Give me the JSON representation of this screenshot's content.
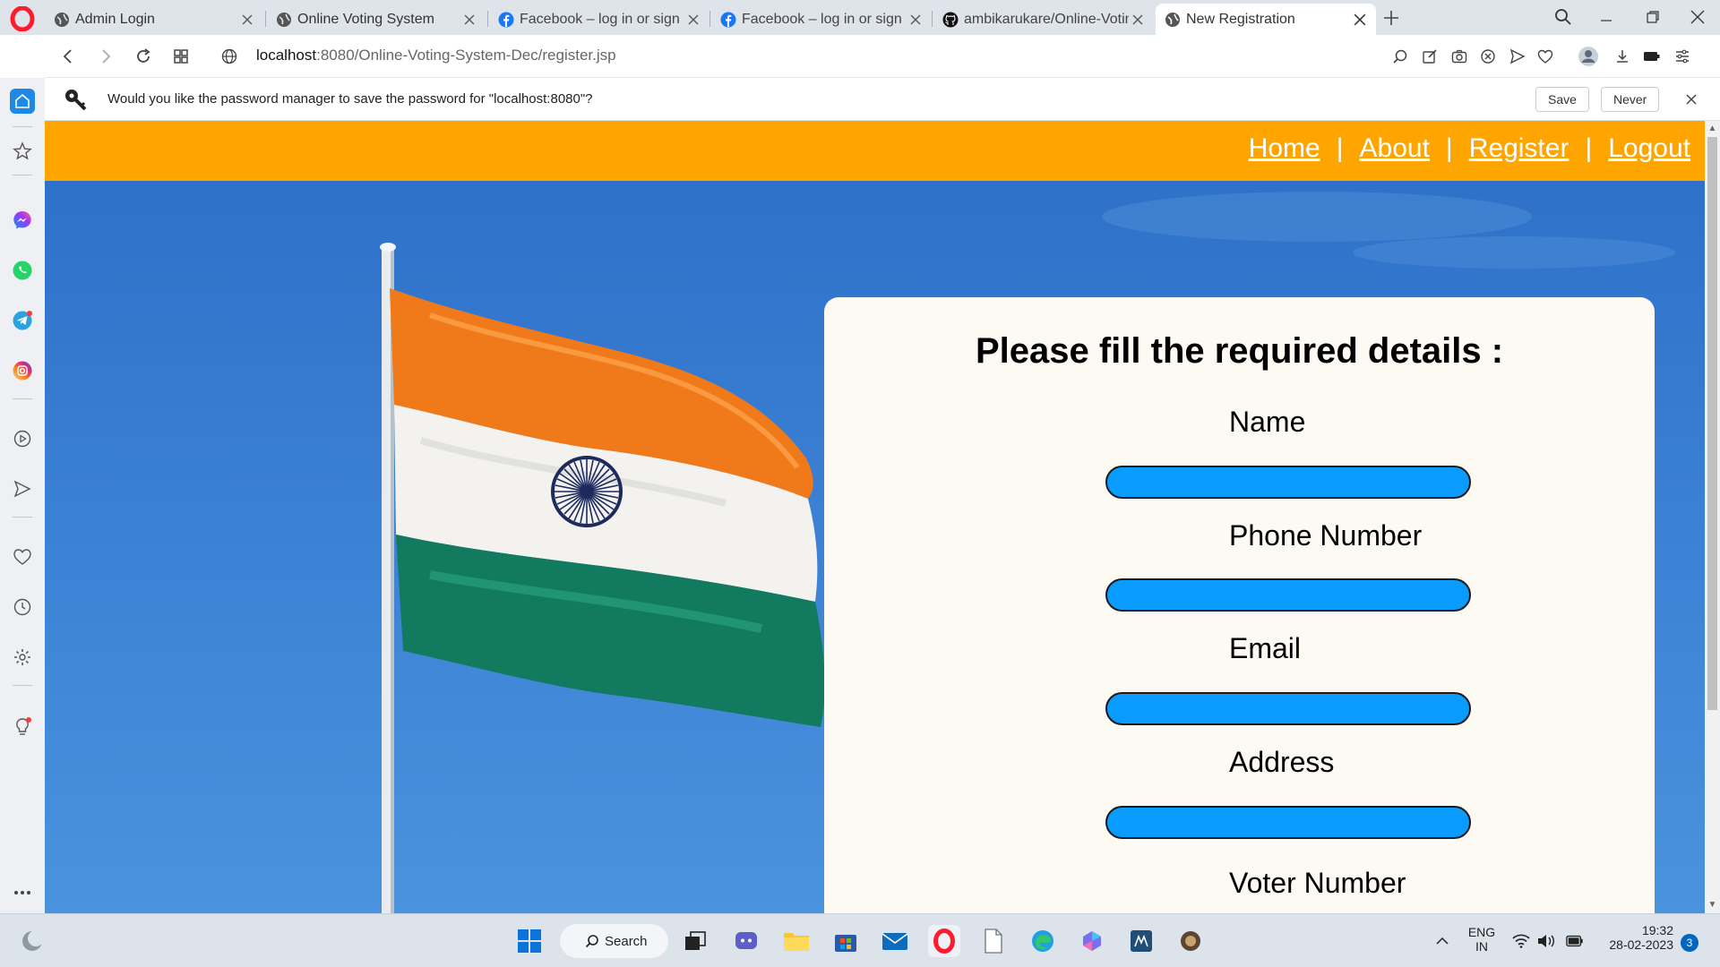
{
  "browser": {
    "tabs": [
      {
        "title": "Admin Login",
        "icon": "globe-icon"
      },
      {
        "title": "Online Voting System",
        "icon": "globe-icon"
      },
      {
        "title": "Facebook – log in or sign u",
        "icon": "facebook-icon"
      },
      {
        "title": "Facebook – log in or sign u",
        "icon": "facebook-icon"
      },
      {
        "title": "ambikarukare/Online-Votin",
        "icon": "github-icon"
      },
      {
        "title": "New Registration",
        "icon": "globe-icon",
        "active": true
      }
    ],
    "address": {
      "host": "localhost",
      "path": ":8080/Online-Voting-System-Dec/register.jsp"
    },
    "password_prompt": {
      "message": "Would you like the password manager to save the password for \"localhost:8080\"?",
      "save_label": "Save",
      "never_label": "Never"
    },
    "accent": "#ff1b2d"
  },
  "site": {
    "header_color": "#ffa500",
    "nav": [
      {
        "label": "Home"
      },
      {
        "label": "About"
      },
      {
        "label": "Register"
      },
      {
        "label": "Logout"
      }
    ],
    "nav_separator": "|"
  },
  "form": {
    "title": "Please fill the required details :",
    "fields": [
      {
        "label": "Name",
        "value": ""
      },
      {
        "label": "Phone Number",
        "value": ""
      },
      {
        "label": "Email",
        "value": ""
      },
      {
        "label": "Address",
        "value": ""
      },
      {
        "label": "Voter Number"
      }
    ],
    "input_color": "#0a9bff"
  },
  "taskbar": {
    "search_label": "Search",
    "language": {
      "line1": "ENG",
      "line2": "IN"
    },
    "clock": {
      "time": "19:32",
      "date": "28-02-2023"
    },
    "notification_count": "3"
  }
}
